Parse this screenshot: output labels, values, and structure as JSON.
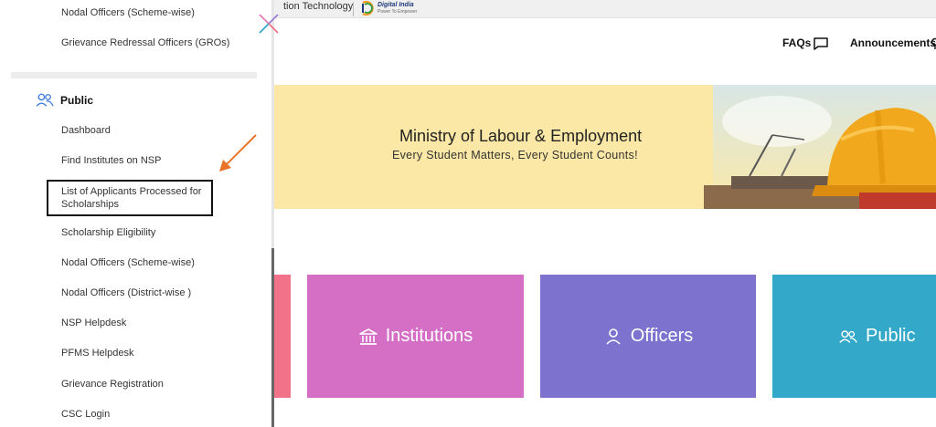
{
  "topbar": {
    "partial_text": "tion Technology",
    "logo_title": "Digital India",
    "logo_subtitle": "Power To Empower"
  },
  "header": {
    "faqs_label": "FAQs",
    "announcements_label": "Announcements"
  },
  "banner": {
    "title": "Ministry of Labour & Employment",
    "subtitle": "Every Student Matters, Every Student Counts!"
  },
  "cards": {
    "institutions": "Institutions",
    "officers": "Officers",
    "public": "Public"
  },
  "sidebar": {
    "top_items": [
      "Nodal Officers (Scheme-wise)",
      "Grievance Redressal Officers (GROs)"
    ],
    "public_heading": "Public",
    "public_items": [
      "Dashboard",
      "Find Institutes on NSP",
      "List of Applicants Processed for",
      "Scholarships",
      "Scholarship Eligibility",
      "Nodal Officers (Scheme-wise)",
      "Nodal Officers (District-wise )",
      "NSP Helpdesk",
      "PFMS Helpdesk",
      "Grievance Registration",
      "CSC Login"
    ]
  },
  "colors": {
    "pink_card": "#f27289",
    "institutions_card": "#d56fc6",
    "officers_card": "#7e72cf",
    "public_card": "#33a8c9",
    "banner_bg": "#fbe8a6",
    "annotation_arrow": "#e8742a"
  },
  "icons": {
    "close": "close-x-icon",
    "faqs": "chat-bubble-icon",
    "institutions": "bank-building-icon",
    "officers": "person-icon",
    "public": "people-icon"
  }
}
